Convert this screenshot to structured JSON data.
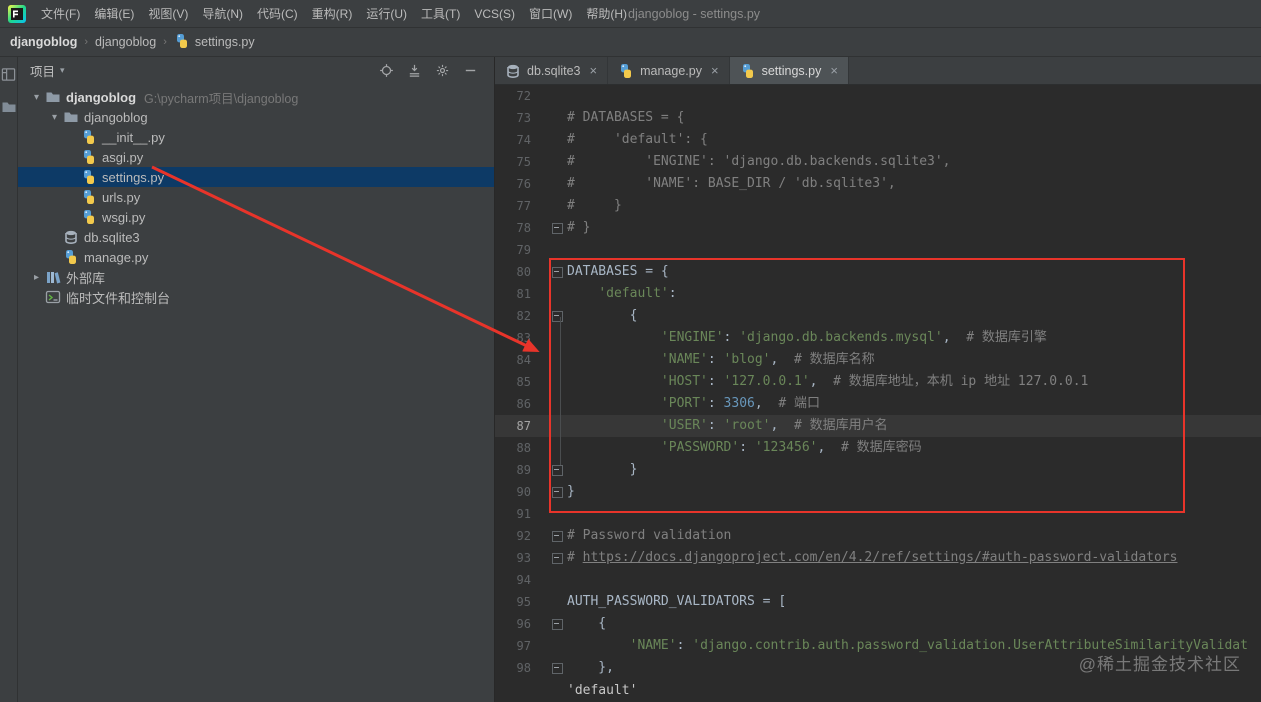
{
  "window": {
    "title": "djangoblog - settings.py"
  },
  "menu_bar": {
    "items": [
      "文件(F)",
      "编辑(E)",
      "视图(V)",
      "导航(N)",
      "代码(C)",
      "重构(R)",
      "运行(U)",
      "工具(T)",
      "VCS(S)",
      "窗口(W)",
      "帮助(H)"
    ]
  },
  "breadcrumb_bar": {
    "separator": "›",
    "items": [
      {
        "label": "djangoblog",
        "bold": true
      },
      {
        "label": "djangoblog"
      },
      {
        "label": "settings.py",
        "icon": "python-file-icon"
      }
    ]
  },
  "tool_window_bar": {
    "icons": [
      "project-view-icon",
      "folder-icon"
    ]
  },
  "project_panel": {
    "title": "项目",
    "header_icons": [
      "locate-icon",
      "collapse-all-icon",
      "settings-gear-icon",
      "hide-icon"
    ],
    "tree": [
      {
        "label": "djangoblog",
        "hint": "G:\\pycharm项目\\djangoblog",
        "level": 0,
        "icon": "folder-icon",
        "arrow": "expanded",
        "bold": true
      },
      {
        "label": "djangoblog",
        "level": 1,
        "icon": "folder-icon",
        "arrow": "expanded"
      },
      {
        "label": "__init__.py",
        "level": 2,
        "icon": "python-file-icon"
      },
      {
        "label": "asgi.py",
        "level": 2,
        "icon": "python-file-icon"
      },
      {
        "label": "settings.py",
        "level": 2,
        "icon": "python-file-icon",
        "selected": true
      },
      {
        "label": "urls.py",
        "level": 2,
        "icon": "python-file-icon"
      },
      {
        "label": "wsgi.py",
        "level": 2,
        "icon": "python-file-icon"
      },
      {
        "label": "db.sqlite3",
        "level": 1,
        "icon": "database-file-icon"
      },
      {
        "label": "manage.py",
        "level": 1,
        "icon": "python-file-icon"
      },
      {
        "label": "外部库",
        "level": 0,
        "icon": "library-icon",
        "arrow": "collapsed"
      },
      {
        "label": "临时文件和控制台",
        "level": 0,
        "icon": "console-icon"
      }
    ]
  },
  "editor": {
    "tabs": [
      {
        "label": "db.sqlite3",
        "icon": "database-file-icon",
        "close": "×",
        "active": false
      },
      {
        "label": "manage.py",
        "icon": "python-file-icon",
        "close": "×",
        "active": false
      },
      {
        "label": "settings.py",
        "icon": "python-file-icon",
        "close": "×",
        "active": true
      }
    ],
    "current_line": 87,
    "breadcrumb_partial": "'default'",
    "lines": [
      {
        "n": 72,
        "seg": []
      },
      {
        "n": 73,
        "seg": [
          [
            "comment",
            "# DATABASES = {"
          ]
        ]
      },
      {
        "n": 74,
        "seg": [
          [
            "comment",
            "#     'default': {"
          ]
        ]
      },
      {
        "n": 75,
        "seg": [
          [
            "comment",
            "#         'ENGINE': 'django.db.backends.sqlite3',"
          ]
        ]
      },
      {
        "n": 76,
        "seg": [
          [
            "comment",
            "#         'NAME': BASE_DIR / 'db.sqlite3',"
          ]
        ]
      },
      {
        "n": 77,
        "seg": [
          [
            "comment",
            "#     }"
          ]
        ]
      },
      {
        "n": 78,
        "fold": true,
        "seg": [
          [
            "comment",
            "# }"
          ]
        ]
      },
      {
        "n": 79,
        "seg": []
      },
      {
        "n": 80,
        "fold": true,
        "seg": [
          [
            "plain",
            "DATABASES = {"
          ]
        ]
      },
      {
        "n": 81,
        "seg": [
          [
            "plain",
            "    "
          ],
          [
            "string",
            "'default'"
          ],
          [
            "plain",
            ":"
          ]
        ]
      },
      {
        "n": 82,
        "fold": true,
        "seg": [
          [
            "plain",
            "        {"
          ]
        ]
      },
      {
        "n": 83,
        "seg": [
          [
            "plain",
            "            "
          ],
          [
            "string",
            "'ENGINE'"
          ],
          [
            "plain",
            ": "
          ],
          [
            "string",
            "'django.db.backends.mysql'"
          ],
          [
            "plain",
            ",  "
          ],
          [
            "comment",
            "# 数据库引擎"
          ]
        ]
      },
      {
        "n": 84,
        "seg": [
          [
            "plain",
            "            "
          ],
          [
            "string",
            "'NAME'"
          ],
          [
            "plain",
            ": "
          ],
          [
            "string",
            "'blog'"
          ],
          [
            "plain",
            ",  "
          ],
          [
            "comment",
            "# 数据库名称"
          ]
        ]
      },
      {
        "n": 85,
        "seg": [
          [
            "plain",
            "            "
          ],
          [
            "string",
            "'HOST'"
          ],
          [
            "plain",
            ": "
          ],
          [
            "string",
            "'127.0.0.1'"
          ],
          [
            "plain",
            ",  "
          ],
          [
            "comment",
            "# 数据库地址，本机 ip 地址 127.0.0.1"
          ]
        ]
      },
      {
        "n": 86,
        "seg": [
          [
            "plain",
            "            "
          ],
          [
            "string",
            "'PORT'"
          ],
          [
            "plain",
            ": "
          ],
          [
            "number",
            "3306"
          ],
          [
            "plain",
            ",  "
          ],
          [
            "comment",
            "# 端口"
          ]
        ]
      },
      {
        "n": 87,
        "seg": [
          [
            "plain",
            "            "
          ],
          [
            "string",
            "'USER'"
          ],
          [
            "plain",
            ": "
          ],
          [
            "string",
            "'root'"
          ],
          [
            "plain",
            ",  "
          ],
          [
            "comment",
            "# 数据库用户名"
          ]
        ]
      },
      {
        "n": 88,
        "seg": [
          [
            "plain",
            "            "
          ],
          [
            "string",
            "'PASSWORD'"
          ],
          [
            "plain",
            ": "
          ],
          [
            "string",
            "'123456'"
          ],
          [
            "plain",
            ",  "
          ],
          [
            "comment",
            "# 数据库密码"
          ]
        ]
      },
      {
        "n": 89,
        "fold": true,
        "seg": [
          [
            "plain",
            "        }"
          ]
        ]
      },
      {
        "n": 90,
        "fold": true,
        "seg": [
          [
            "plain",
            "}"
          ]
        ]
      },
      {
        "n": 91,
        "seg": []
      },
      {
        "n": 92,
        "fold": true,
        "seg": [
          [
            "comment",
            "# Password validation"
          ]
        ]
      },
      {
        "n": 93,
        "fold": true,
        "seg": [
          [
            "comment",
            "# "
          ],
          [
            "link",
            "https://docs.djangoproject.com/en/4.2/ref/settings/#auth-password-validators"
          ]
        ]
      },
      {
        "n": 94,
        "seg": []
      },
      {
        "n": 95,
        "seg": [
          [
            "plain",
            "AUTH_PASSWORD_VALIDATORS = ["
          ]
        ]
      },
      {
        "n": 96,
        "fold": true,
        "seg": [
          [
            "plain",
            "    {"
          ]
        ]
      },
      {
        "n": 97,
        "seg": [
          [
            "plain",
            "        "
          ],
          [
            "string",
            "'NAME'"
          ],
          [
            "plain",
            ": "
          ],
          [
            "string",
            "'django.contrib.auth.password_validation.UserAttributeSimilarityValidat"
          ]
        ]
      },
      {
        "n": 98,
        "fold": true,
        "seg": [
          [
            "plain",
            "    },"
          ]
        ]
      }
    ]
  },
  "annotations": {
    "red_color": "#e8342a",
    "box_lines": "80-90",
    "watermark": "@稀土掘金技术社区"
  },
  "colors": {
    "panel_bg": "#3c3f41",
    "editor_bg": "#2b2b2b",
    "selection_blue": "#0d3a66",
    "string_green": "#6a8759",
    "comment_gray": "#808080",
    "number_blue": "#6897bb",
    "plain_text": "#a9b7c6"
  }
}
